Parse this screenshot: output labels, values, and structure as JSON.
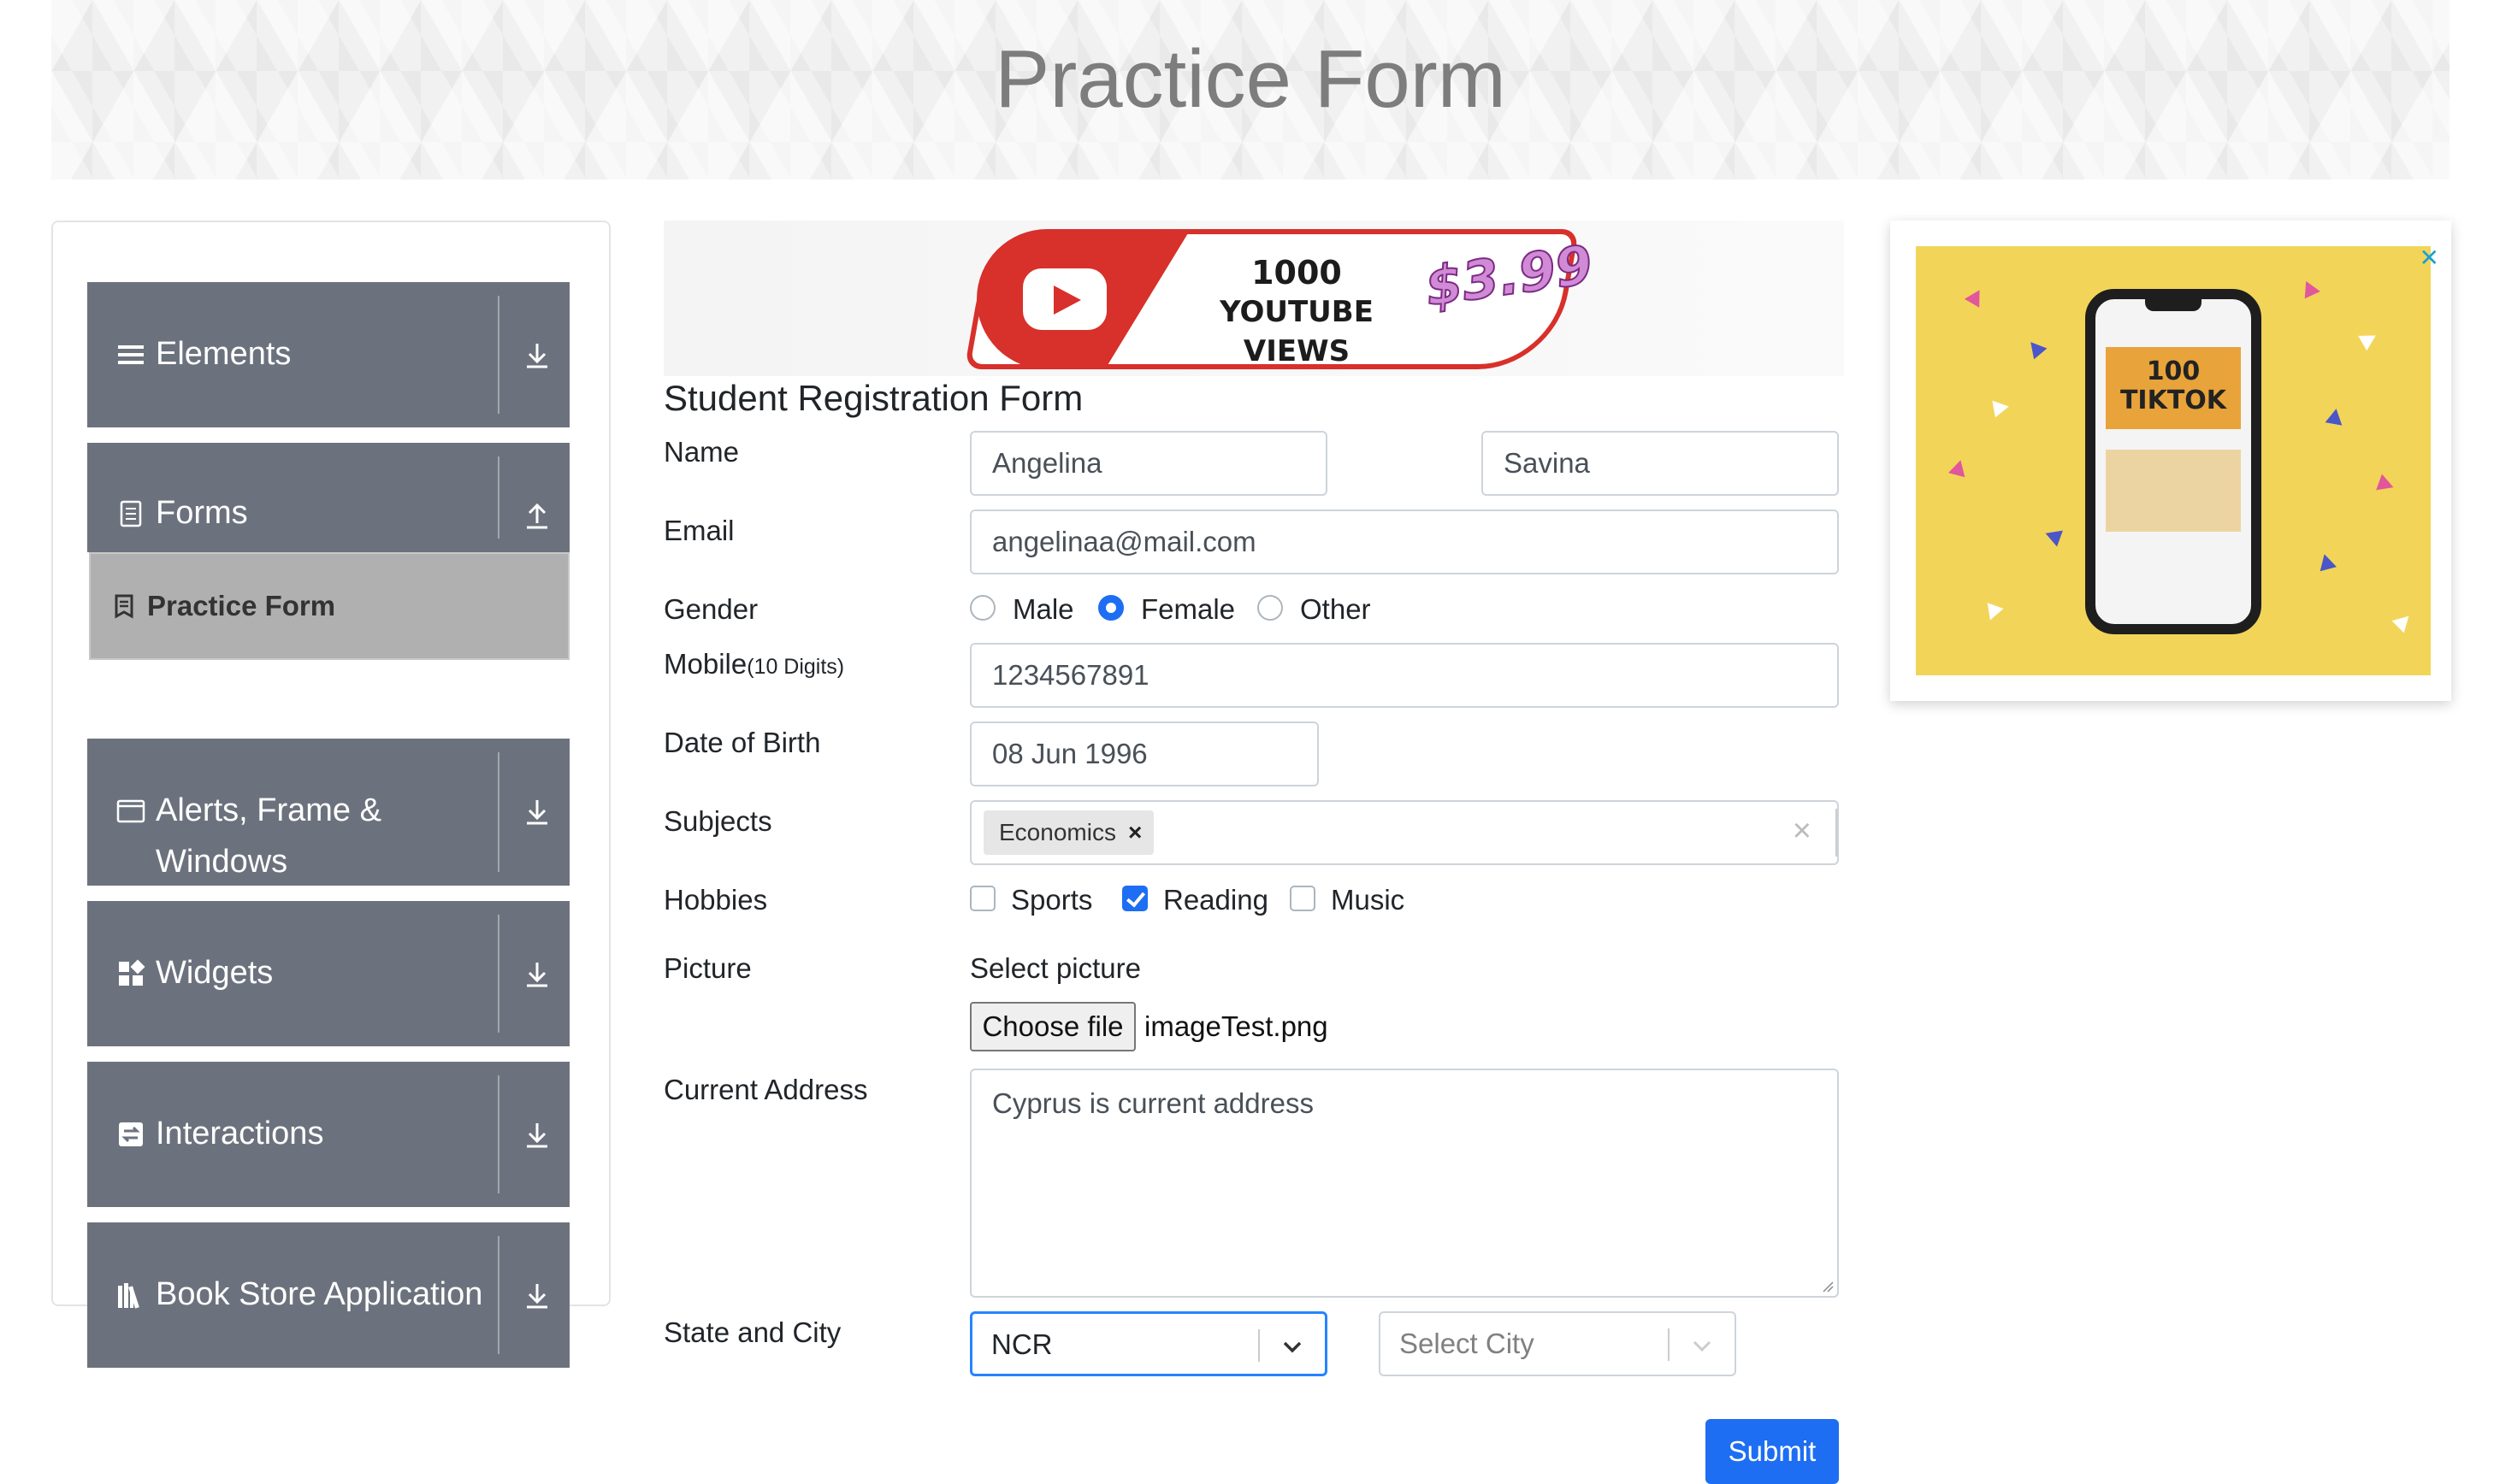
{
  "header": {
    "title": "Practice Form"
  },
  "sidebar": {
    "groups": [
      {
        "label": "Elements",
        "icon": "list-icon",
        "toggle": "download-icon"
      },
      {
        "label": "Forms",
        "icon": "document-icon",
        "toggle": "upload-icon"
      },
      {
        "label": "Alerts, Frame &",
        "label2": "Windows",
        "icon": "window-icon",
        "toggle": "download-icon"
      },
      {
        "label": "Widgets",
        "icon": "widgets-icon",
        "toggle": "download-icon"
      },
      {
        "label": "Interactions",
        "icon": "interactions-icon",
        "toggle": "download-icon"
      },
      {
        "label": "Book Store Application",
        "icon": "books-icon",
        "toggle": "download-icon"
      }
    ],
    "active_item": {
      "label": "Practice Form",
      "icon": "form-icon"
    }
  },
  "top_ad": {
    "line1": "1000",
    "line2": "YOUTUBE VIEWS",
    "price": "$3.99"
  },
  "form": {
    "title": "Student Registration Form",
    "labels": {
      "name": "Name",
      "email": "Email",
      "gender": "Gender",
      "mobile": "Mobile",
      "mobile_hint": "(10 Digits)",
      "dob": "Date of Birth",
      "subjects": "Subjects",
      "hobbies": "Hobbies",
      "picture": "Picture",
      "address": "Current Address",
      "state_city": "State and City"
    },
    "first_name": "Angelina",
    "last_name": "Savina",
    "email": "angelinaa@mail.com",
    "gender_options": [
      {
        "label": "Male",
        "checked": false
      },
      {
        "label": "Female",
        "checked": true
      },
      {
        "label": "Other",
        "checked": false
      }
    ],
    "mobile": "1234567891",
    "dob": "08 Jun 1996",
    "subjects": [
      "Economics"
    ],
    "chip_remove": "×",
    "clear_all": "×",
    "hobbies": [
      {
        "label": "Sports",
        "checked": false
      },
      {
        "label": "Reading",
        "checked": true
      },
      {
        "label": "Music",
        "checked": false
      }
    ],
    "picture_prompt": "Select picture",
    "choose_file_label": "Choose file",
    "file_name": "imageTest.png",
    "address": "Cyprus is current address",
    "state": "NCR",
    "city_placeholder": "Select City",
    "submit_label": "Submit"
  },
  "side_ad": {
    "card_line1": "100",
    "card_line2": "TIKTOK",
    "close": "✕"
  },
  "colors": {
    "sidebar": "#6c727d",
    "active_item": "#b0b0b0",
    "primary": "#1d6ef2",
    "ad_yellow": "#f2d558",
    "youtube_red": "#d8302a"
  }
}
